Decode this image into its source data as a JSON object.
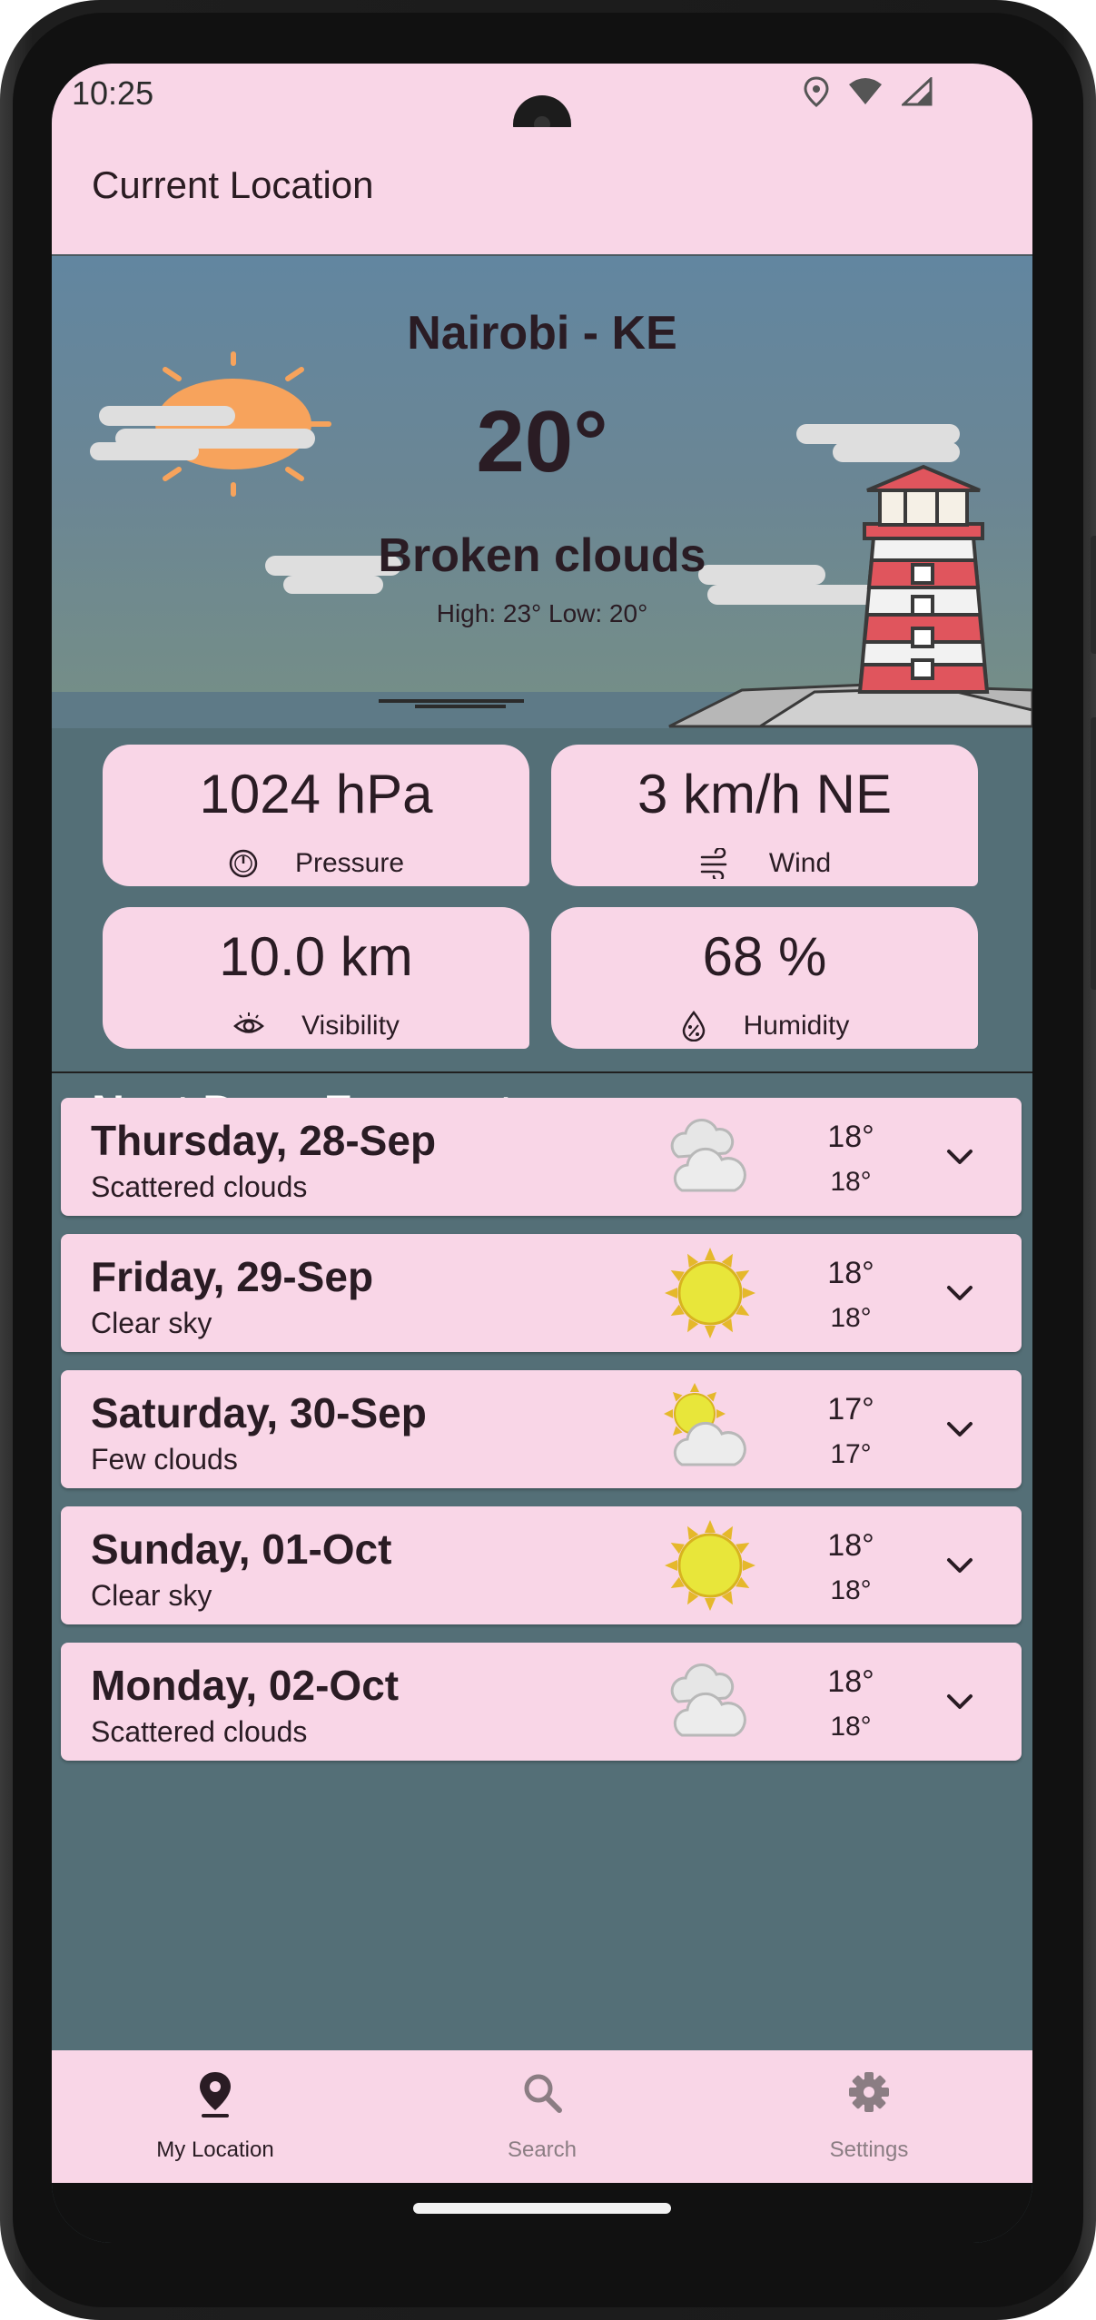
{
  "status": {
    "time": "10:25"
  },
  "appbar": {
    "title": "Current Location"
  },
  "current": {
    "city": "Nairobi - KE",
    "temperature": "20°",
    "description": "Broken clouds",
    "high_low": "High: 23° Low: 20°"
  },
  "stats": [
    {
      "value": "1024 hPa",
      "label": "Pressure",
      "icon": "gauge-icon"
    },
    {
      "value": "3 km/h NE",
      "label": "Wind",
      "icon": "wind-icon"
    },
    {
      "value": "10.0 km",
      "label": "Visibility",
      "icon": "eye-icon"
    },
    {
      "value": "68 %",
      "label": "Humidity",
      "icon": "humidity-icon"
    }
  ],
  "forecast": {
    "title": "Next Days Forecast",
    "days": [
      {
        "day": "Thursday, 28-Sep",
        "desc": "Scattered clouds",
        "hi": "18°",
        "lo": "18°",
        "icon": "clouds-icon"
      },
      {
        "day": "Friday, 29-Sep",
        "desc": "Clear sky",
        "hi": "18°",
        "lo": "18°",
        "icon": "sun-icon"
      },
      {
        "day": "Saturday, 30-Sep",
        "desc": "Few clouds",
        "hi": "17°",
        "lo": "17°",
        "icon": "sun-cloud-icon"
      },
      {
        "day": "Sunday, 01-Oct",
        "desc": "Clear sky",
        "hi": "18°",
        "lo": "18°",
        "icon": "sun-icon"
      },
      {
        "day": "Monday, 02-Oct",
        "desc": "Scattered clouds",
        "hi": "18°",
        "lo": "18°",
        "icon": "clouds-icon"
      }
    ]
  },
  "nav": {
    "items": [
      {
        "label": "My Location",
        "icon": "location-pin-icon",
        "active": true
      },
      {
        "label": "Search",
        "icon": "search-icon",
        "active": false
      },
      {
        "label": "Settings",
        "icon": "gear-icon",
        "active": false
      }
    ]
  },
  "colors": {
    "surface": "#f9d6e7",
    "background": "#546f77",
    "text": "#2a1c24",
    "inactive": "#8b7d83"
  }
}
